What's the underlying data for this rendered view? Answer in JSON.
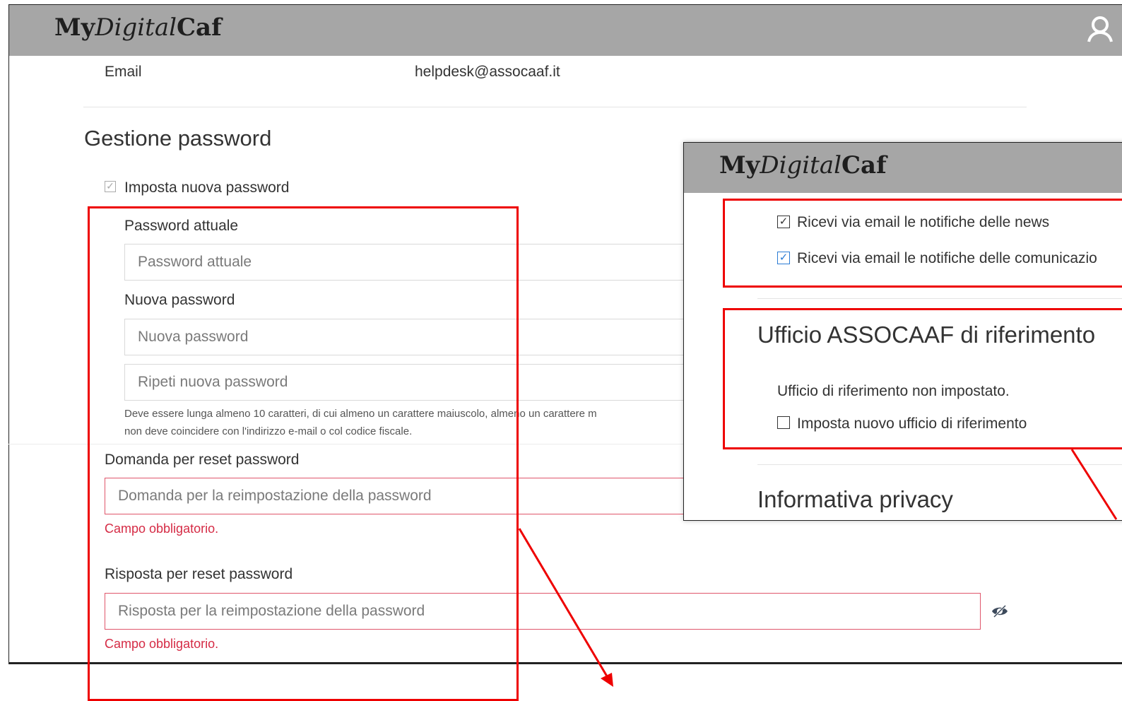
{
  "main_window": {
    "logo": {
      "my": "My",
      "digital": "Digital",
      "caf": "Caf"
    },
    "email_label": "Email",
    "email_value": "helpdesk@assocaaf.it",
    "section_title": "Gestione password",
    "set_new_password_label": "Imposta nuova password",
    "current_password_label": "Password attuale",
    "current_password_placeholder": "Password attuale",
    "new_password_label": "Nuova password",
    "new_password_placeholder": "Nuova password",
    "repeat_password_placeholder": "Ripeti nuova password",
    "password_hint_line1": "Deve essere lunga almeno 10 caratteri, di cui almeno un carattere maiuscolo, almeno un carattere m",
    "password_hint_line2": "non deve coincidere con l'indirizzo e-mail o col codice fiscale.",
    "reset_question_label": "Domanda per reset password",
    "reset_question_placeholder": "Domanda per la reimpostazione della password",
    "reset_question_error": "Campo obbligatorio.",
    "reset_answer_label": "Risposta per reset password",
    "reset_answer_placeholder": "Risposta per la reimpostazione della password",
    "reset_answer_error": "Campo obbligatorio."
  },
  "overlay_window": {
    "logo": {
      "my": "My",
      "digital": "Digital",
      "caf": "Caf"
    },
    "news_notifications_label": "Ricevi via email le notifiche delle news",
    "communications_notifications_label": "Ricevi via email le notifiche delle comunicazio",
    "office_title": "Ufficio ASSOCAAF di riferimento",
    "office_status": "Ufficio di riferimento non impostato.",
    "set_office_label": "Imposta nuovo ufficio di riferimento",
    "privacy_title": "Informativa privacy"
  },
  "icons": {
    "user": "user-icon",
    "check": "☑",
    "eye": "eye-slash-icon"
  },
  "colors": {
    "header_bar": "#a6a6a6",
    "annotation_red": "#ee0000",
    "error_red": "#d52b45",
    "checkbox_blue": "#2a7bd4"
  }
}
